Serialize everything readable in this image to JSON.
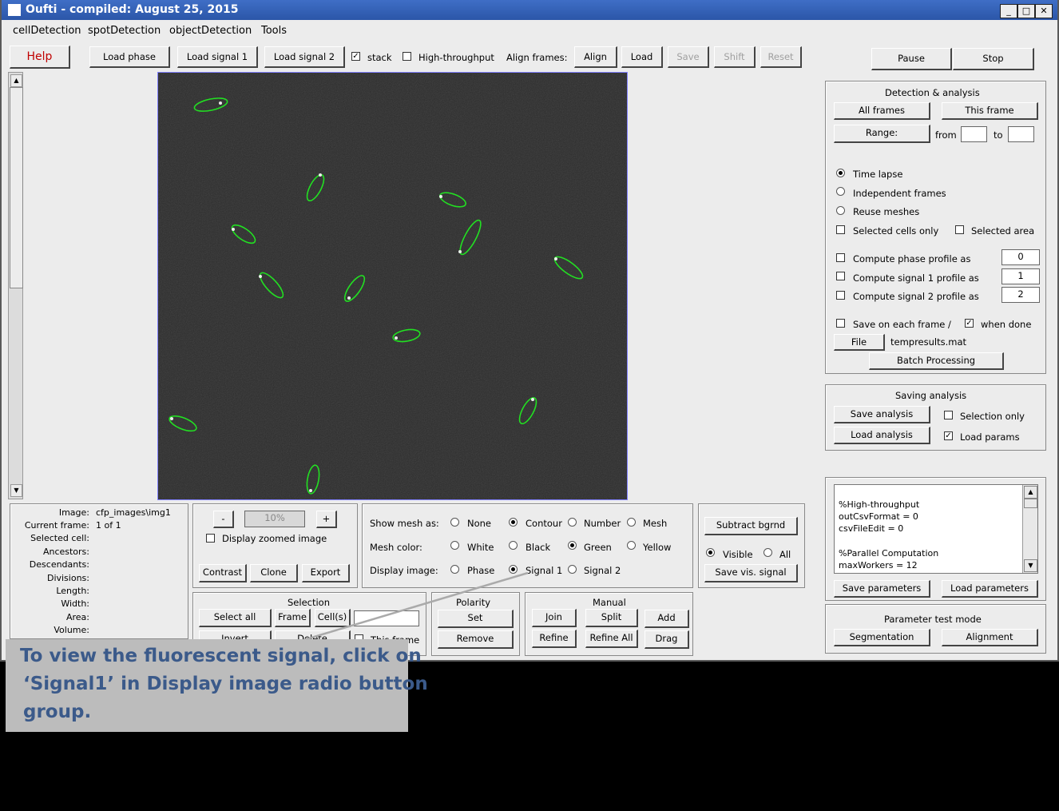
{
  "window": {
    "title": "Oufti - compiled:  August 25, 2015"
  },
  "menu": [
    "cellDetection",
    "spotDetection",
    "objectDetection",
    "Tools"
  ],
  "toolbar": {
    "help": "Help",
    "load_phase": "Load phase",
    "load_signal1": "Load signal 1",
    "load_signal2": "Load signal 2",
    "stack": "stack",
    "stack_checked": true,
    "high_throughput": "High-throughput",
    "align_frames": "Align frames:",
    "align": "Align",
    "load": "Load",
    "save": "Save",
    "shift": "Shift",
    "reset": "Reset",
    "pause": "Pause",
    "stop": "Stop"
  },
  "detection": {
    "title": "Detection & analysis",
    "all_frames": "All frames",
    "this_frame": "This frame",
    "range": "Range:",
    "from": "from",
    "to": "to",
    "time_lapse": "Time lapse",
    "independent_frames": "Independent frames",
    "reuse_meshes": "Reuse meshes",
    "selected_cells_only": "Selected cells only",
    "selected_area": "Selected area",
    "phase_profile": "Compute phase profile as",
    "phase_profile_val": "0",
    "signal1_profile": "Compute signal 1 profile as",
    "signal1_profile_val": "1",
    "signal2_profile": "Compute signal 2 profile as",
    "signal2_profile_val": "2",
    "save_each_frame": "Save on each frame /",
    "when_done": "when done",
    "file": "File",
    "filename": "tempresults.mat",
    "batch": "Batch Processing"
  },
  "saving": {
    "title": "Saving analysis",
    "save_analysis": "Save analysis",
    "selection_only": "Selection only",
    "load_analysis": "Load analysis",
    "load_params": "Load params"
  },
  "params": {
    "lines": [
      "%High-throughput",
      "outCsvFormat = 0",
      "csvFileEdit = 0",
      "",
      "%Parallel Computation",
      "maxWorkers = 12"
    ],
    "save_parameters": "Save parameters",
    "load_parameters": "Load parameters",
    "test_mode": "Parameter test mode",
    "segmentation": "Segmentation",
    "alignment": "Alignment"
  },
  "info": {
    "image_label": "Image:",
    "image_value": "cfp_images\\img1",
    "frame_label": "Current frame:",
    "frame_value": "1 of 1",
    "selected_label": "Selected cell:",
    "ancestors_label": "Ancestors:",
    "descendants_label": "Descendants:",
    "divisions_label": "Divisions:",
    "length_label": "Length:",
    "width_label": "Width:",
    "area_label": "Area:",
    "volume_label": "Volume:"
  },
  "zoom": {
    "minus": "-",
    "value": "10%",
    "plus": "+",
    "display_zoomed": "Display zoomed image",
    "contrast": "Contrast",
    "clone": "Clone",
    "export": "Export"
  },
  "display": {
    "show_mesh_as": "Show mesh as:",
    "none": "None",
    "contour": "Contour",
    "number": "Number",
    "mesh": "Mesh",
    "mesh_color": "Mesh color:",
    "white": "White",
    "black": "Black",
    "green": "Green",
    "yellow": "Yellow",
    "display_image": "Display image:",
    "phase": "Phase",
    "signal1": "Signal 1",
    "signal2": "Signal 2"
  },
  "background": {
    "subtract": "Subtract bgrnd",
    "visible": "Visible",
    "all": "All",
    "save_vis": "Save vis. signal"
  },
  "selection": {
    "title": "Selection",
    "select_all": "Select all",
    "frame": "Frame",
    "cells": "Cell(s)",
    "invert": "Invert",
    "delete": "Delete",
    "this_frame": "This frame"
  },
  "polarity": {
    "title": "Polarity",
    "set": "Set",
    "remove": "Remove"
  },
  "manual": {
    "title": "Manual",
    "join": "Join",
    "split": "Split",
    "add": "Add",
    "refine": "Refine",
    "refine_all": "Refine All",
    "drag": "Drag"
  },
  "callout": {
    "line1": "To view the fluorescent signal, click on",
    "line2": "‘Signal1’ in Display image radio button",
    "line3": "group."
  }
}
